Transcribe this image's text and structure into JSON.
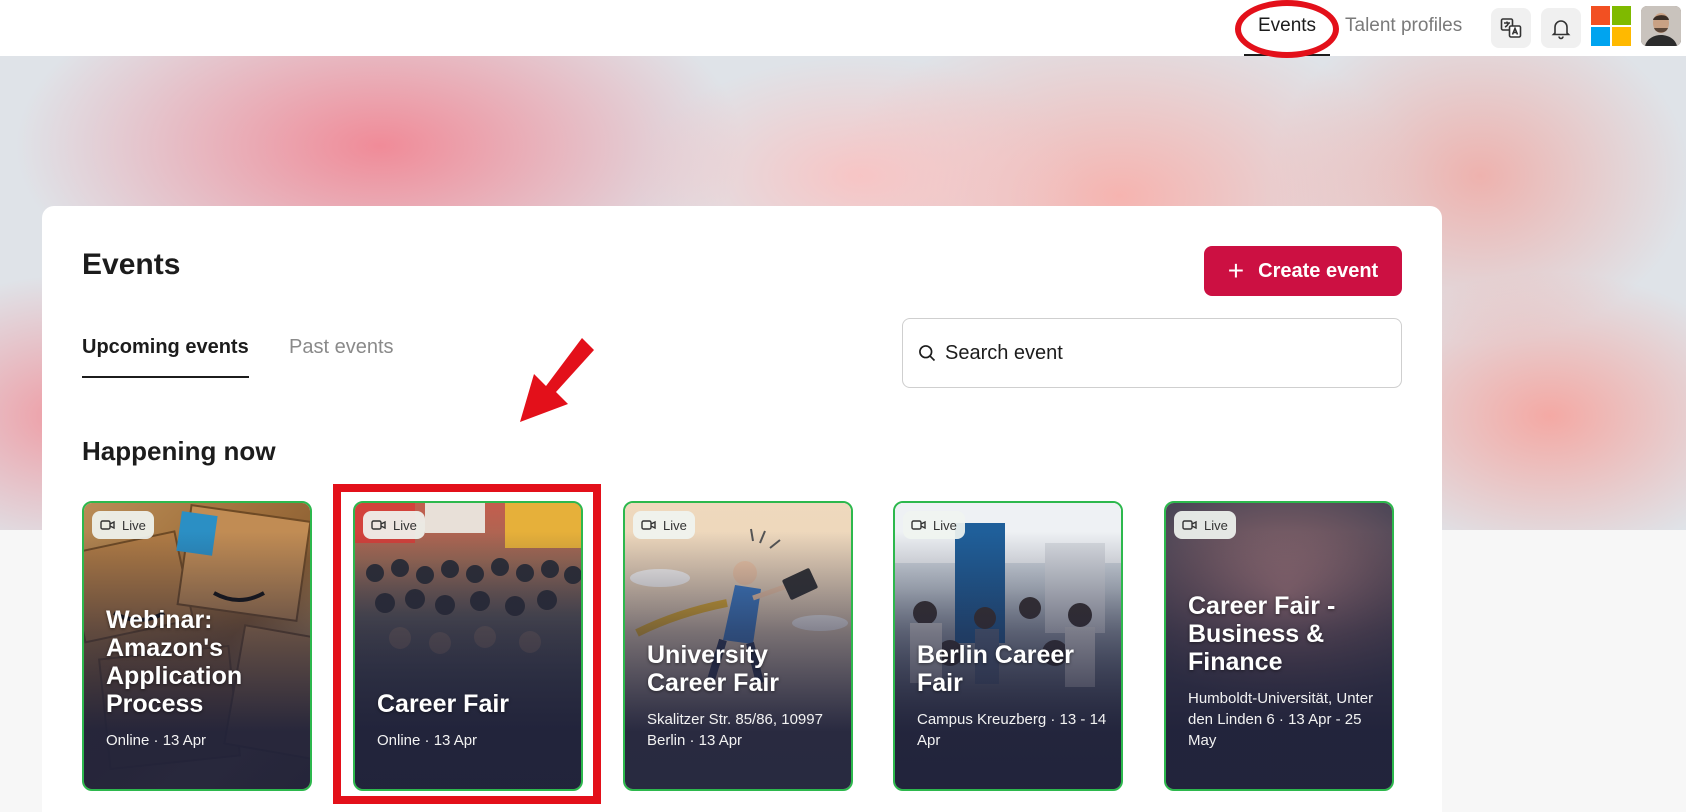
{
  "nav": {
    "events_label": "Events",
    "talent_label": "Talent profiles"
  },
  "page": {
    "title": "Events",
    "create_label": "Create event",
    "tabs": [
      {
        "label": "Upcoming events",
        "active": true
      },
      {
        "label": "Past events",
        "active": false
      }
    ],
    "search_placeholder": "Search event",
    "section_title": "Happening now"
  },
  "cards": [
    {
      "badge": "Live",
      "title": "Webinar: Amazon's Application Process",
      "meta": "Online · 13 Apr"
    },
    {
      "badge": "Live",
      "title": "Career Fair",
      "meta": "Online · 13 Apr"
    },
    {
      "badge": "Live",
      "title": "University Career Fair",
      "meta": "Skalitzer Str. 85/86, 10997 Berlin · 13 Apr"
    },
    {
      "badge": "Live",
      "title": "Berlin Career Fair",
      "meta": "Campus Kreuzberg · 13 - 14 Apr"
    },
    {
      "badge": "Live",
      "title": "Career Fair - Business & Finance",
      "meta": "Humboldt-Universität, Unter den Linden 6 · 13 Apr - 25 May"
    }
  ],
  "colors": {
    "accent": "#cc1042",
    "live_border": "#2db84d",
    "annotation": "#e3101a"
  }
}
